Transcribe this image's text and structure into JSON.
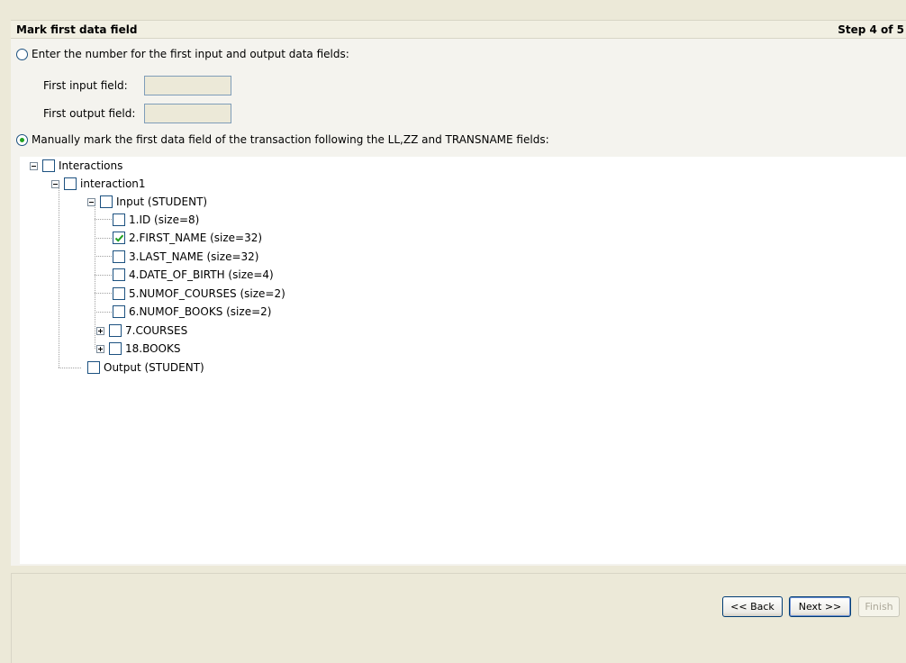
{
  "header": {
    "title": "Mark first data field",
    "step": "Step 4 of 5"
  },
  "options": {
    "enter_number_label": "Enter the number for the first input and output data fields:",
    "first_input_label": "First input field:",
    "first_input_value": "",
    "first_output_label": "First output field:",
    "first_output_value": "",
    "manual_label": "Manually mark the first data field of the transaction following the LL,ZZ and TRANSNAME fields:",
    "selected": "manual"
  },
  "tree": {
    "root": "Interactions",
    "interaction": "interaction1",
    "input": "Input (STUDENT)",
    "fields": [
      {
        "label": "1.ID (size=8)",
        "checked": false
      },
      {
        "label": "2.FIRST_NAME (size=32)",
        "checked": true
      },
      {
        "label": "3.LAST_NAME (size=32)",
        "checked": false
      },
      {
        "label": "4.DATE_OF_BIRTH (size=4)",
        "checked": false
      },
      {
        "label": "5.NUMOF_COURSES (size=2)",
        "checked": false
      },
      {
        "label": "6.NUMOF_BOOKS (size=2)",
        "checked": false
      },
      {
        "label": "7.COURSES",
        "checked": false
      },
      {
        "label": "18.BOOKS",
        "checked": false
      }
    ],
    "output": "Output (STUDENT)"
  },
  "buttons": {
    "back": "<< Back",
    "next": "Next >>",
    "finish": "Finish"
  },
  "colors": {
    "check_green": "#21a121",
    "accent_blue": "#1c5180"
  },
  "icons": {
    "collapse": "minus-square-icon",
    "expand": "plus-square-icon",
    "check": "checkmark-icon"
  }
}
